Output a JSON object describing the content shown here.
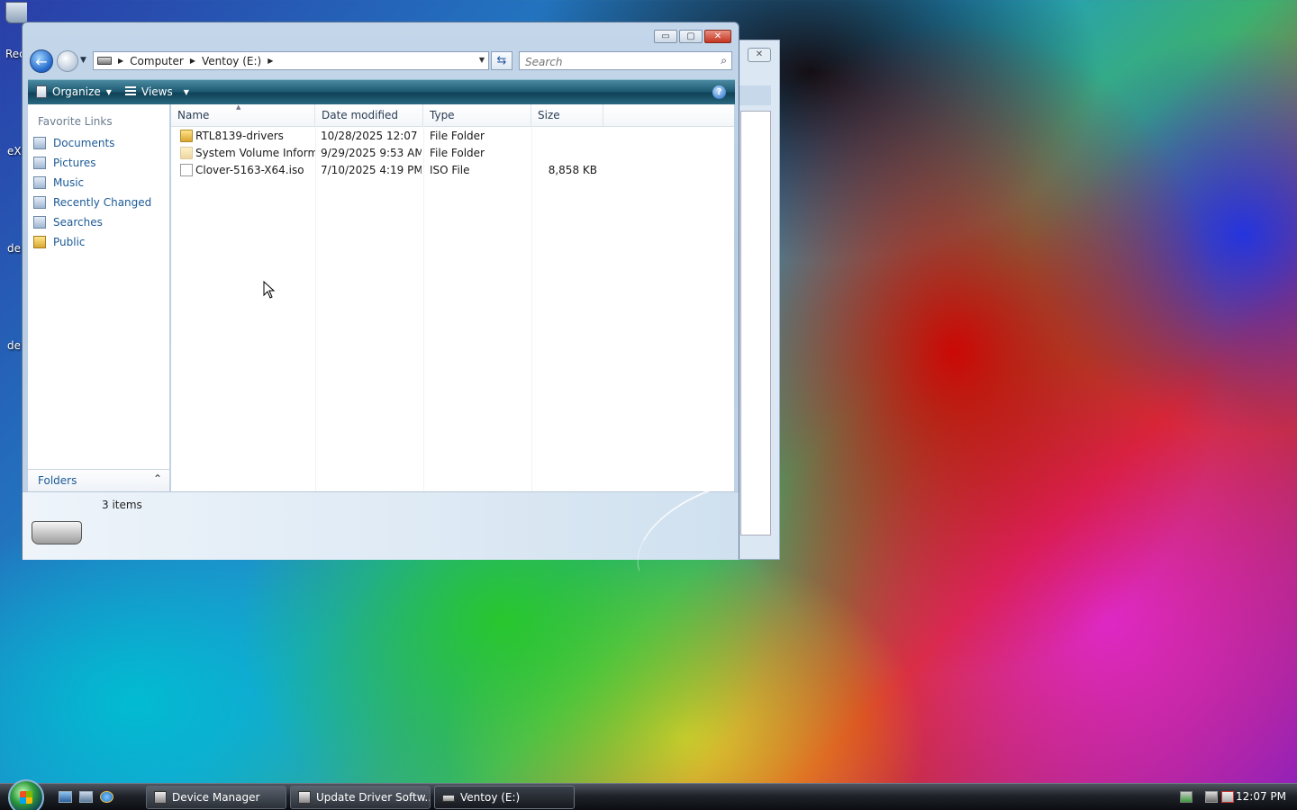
{
  "desktop": {
    "icons": [
      {
        "label": "Rec"
      },
      {
        "label": "eXl"
      },
      {
        "label": "de"
      },
      {
        "label": "de"
      }
    ]
  },
  "window": {
    "captions": {
      "minimize": "▭",
      "maximize": "▢",
      "close": "✕"
    },
    "address": {
      "segments": [
        "Computer",
        "Ventoy (E:)"
      ]
    },
    "search": {
      "placeholder": "Search"
    },
    "toolbar": {
      "organize": "Organize",
      "views": "Views",
      "help": "?"
    },
    "nav": {
      "header": "Favorite Links",
      "items": [
        {
          "label": "Documents",
          "icon": "documents-icon"
        },
        {
          "label": "Pictures",
          "icon": "pictures-icon"
        },
        {
          "label": "Music",
          "icon": "music-icon"
        },
        {
          "label": "Recently Changed",
          "icon": "recently-changed-icon"
        },
        {
          "label": "Searches",
          "icon": "searches-icon"
        },
        {
          "label": "Public",
          "icon": "folder-icon"
        }
      ],
      "folders_label": "Folders"
    },
    "columns": {
      "name": "Name",
      "date": "Date modified",
      "type": "Type",
      "size": "Size"
    },
    "files": [
      {
        "name": "RTL8139-drivers",
        "date": "10/28/2025 12:07 ...",
        "type": "File Folder",
        "size": "",
        "icon": "folder"
      },
      {
        "name": "System Volume Inform...",
        "date": "9/29/2025 9:53 AM",
        "type": "File Folder",
        "size": "",
        "icon": "folder-hidden"
      },
      {
        "name": "Clover-5163-X64.iso",
        "date": "7/10/2025 4:19 PM",
        "type": "ISO File",
        "size": "8,858 KB",
        "icon": "file"
      }
    ],
    "details": {
      "count": "3 items"
    }
  },
  "taskbar": {
    "tasks": [
      {
        "label": "Device Manager"
      },
      {
        "label": "Update Driver Softw..."
      },
      {
        "label": "Ventoy (E:)"
      }
    ],
    "clock": "12:07 PM"
  },
  "colors": {
    "nav_link": "#1c5a96",
    "toolbar": "#1f5c74"
  }
}
